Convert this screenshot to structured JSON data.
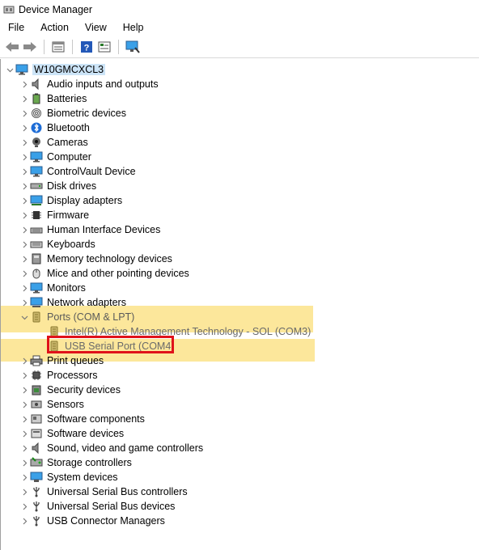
{
  "window": {
    "title": "Device Manager"
  },
  "menu": [
    "File",
    "Action",
    "View",
    "Help"
  ],
  "tree": {
    "root": "W10GMCXCL3",
    "categories": [
      {
        "label": "Audio inputs and outputs",
        "icon": "speaker-icon"
      },
      {
        "label": "Batteries",
        "icon": "battery-icon"
      },
      {
        "label": "Biometric devices",
        "icon": "fingerprint-icon"
      },
      {
        "label": "Bluetooth",
        "icon": "bluetooth-icon"
      },
      {
        "label": "Cameras",
        "icon": "camera-icon"
      },
      {
        "label": "Computer",
        "icon": "computer-icon"
      },
      {
        "label": "ControlVault Device",
        "icon": "monitor-icon"
      },
      {
        "label": "Disk drives",
        "icon": "disk-drive-icon"
      },
      {
        "label": "Display adapters",
        "icon": "display-adapter-icon"
      },
      {
        "label": "Firmware",
        "icon": "chip-icon"
      },
      {
        "label": "Human Interface Devices",
        "icon": "hid-icon"
      },
      {
        "label": "Keyboards",
        "icon": "keyboard-icon"
      },
      {
        "label": "Memory technology devices",
        "icon": "memory-icon"
      },
      {
        "label": "Mice and other pointing devices",
        "icon": "mouse-icon"
      },
      {
        "label": "Monitors",
        "icon": "monitor-icon"
      },
      {
        "label": "Network adapters",
        "icon": "network-icon"
      },
      {
        "label": "Ports (COM & LPT)",
        "icon": "port-icon",
        "expanded": true,
        "children": [
          {
            "label": "Intel(R) Active Management Technology - SOL (COM3)"
          },
          {
            "label": "USB Serial Port (COM4)"
          }
        ]
      },
      {
        "label": "Print queues",
        "icon": "printer-icon"
      },
      {
        "label": "Processors",
        "icon": "processor-icon"
      },
      {
        "label": "Security devices",
        "icon": "security-icon"
      },
      {
        "label": "Sensors",
        "icon": "sensor-icon"
      },
      {
        "label": "Software components",
        "icon": "software-component-icon"
      },
      {
        "label": "Software devices",
        "icon": "software-device-icon"
      },
      {
        "label": "Sound, video and game controllers",
        "icon": "sound-icon"
      },
      {
        "label": "Storage controllers",
        "icon": "storage-icon"
      },
      {
        "label": "System devices",
        "icon": "system-icon"
      },
      {
        "label": "Universal Serial Bus controllers",
        "icon": "usb-icon"
      },
      {
        "label": "Universal Serial Bus devices",
        "icon": "usb-icon"
      },
      {
        "label": "USB Connector Managers",
        "icon": "usb-icon"
      }
    ]
  },
  "colors": {
    "highlight": "#fbe38a",
    "selection_box": "#e0121a"
  }
}
